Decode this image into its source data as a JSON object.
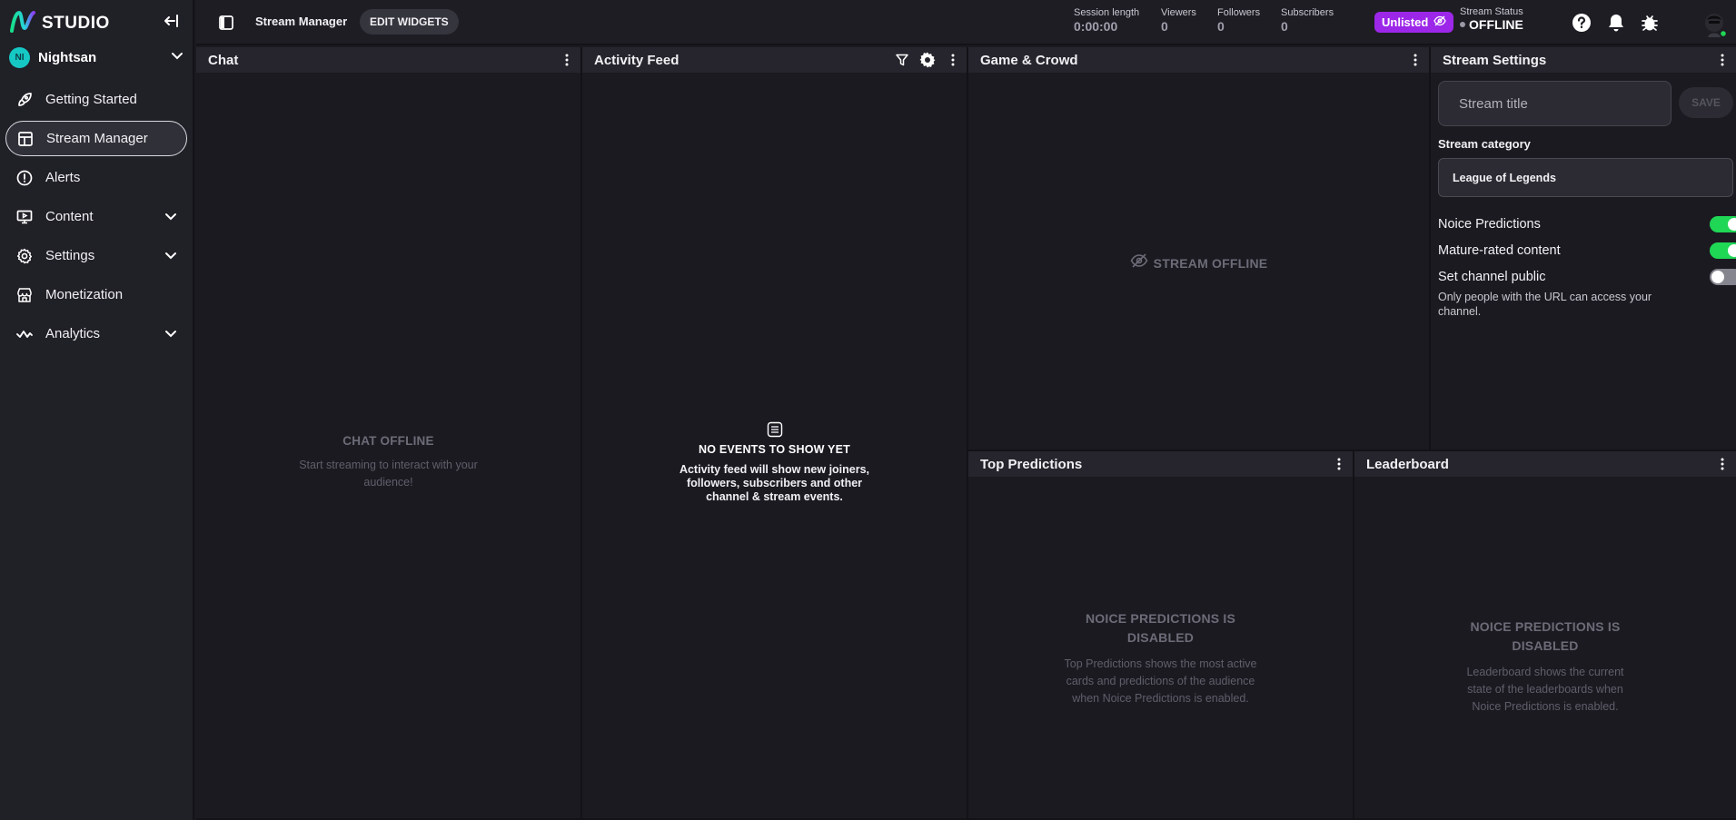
{
  "brand": {
    "name": "STUDIO"
  },
  "channel": {
    "initials": "NI",
    "name": "Nightsan"
  },
  "nav": {
    "items": [
      {
        "label": "Getting Started"
      },
      {
        "label": "Stream Manager"
      },
      {
        "label": "Alerts"
      },
      {
        "label": "Content"
      },
      {
        "label": "Settings"
      },
      {
        "label": "Monetization"
      },
      {
        "label": "Analytics"
      }
    ]
  },
  "topbar": {
    "breadcrumb": "Stream Manager",
    "edit_widgets": "EDIT WIDGETS",
    "stats": [
      {
        "label": "Session length",
        "value": "0:00:00"
      },
      {
        "label": "Viewers",
        "value": "0"
      },
      {
        "label": "Followers",
        "value": "0"
      },
      {
        "label": "Subscribers",
        "value": "0"
      }
    ],
    "visibility_badge": "Unlisted",
    "stream_status_label": "Stream Status",
    "stream_status_value": "OFFLINE"
  },
  "chat": {
    "title": "Chat",
    "empty_title": "CHAT OFFLINE",
    "empty_desc": "Start streaming to interact with your audience!"
  },
  "activity": {
    "title": "Activity Feed",
    "empty_title": "NO EVENTS TO SHOW YET",
    "empty_desc": "Activity feed will show new joiners, followers, subscribers and other channel & stream events."
  },
  "game": {
    "title": "Game & Crowd",
    "empty_title": "STREAM OFFLINE"
  },
  "settings": {
    "title": "Stream Settings",
    "title_placeholder": "Stream title",
    "title_value": "",
    "save_label": "SAVE",
    "category_label": "Stream category",
    "category_value": "League of Legends",
    "toggles": [
      {
        "label": "Noice Predictions",
        "on": true
      },
      {
        "label": "Mature-rated content",
        "on": true
      },
      {
        "label": "Set channel public",
        "on": false
      }
    ],
    "public_hint": "Only people with the URL can access your channel."
  },
  "predictions": {
    "title": "Top Predictions",
    "empty_title": "NOICE PREDICTIONS IS DISABLED",
    "empty_desc": "Top Predictions shows the most active cards and predictions of the audience when Noice Predictions is enabled."
  },
  "leaderboard": {
    "title": "Leaderboard",
    "empty_title": "NOICE PREDICTIONS IS DISABLED",
    "empty_desc": "Leaderboard shows the current state of the leaderboards when Noice Predictions is enabled."
  },
  "colors": {
    "accent_purple": "#9c27e8",
    "toggle_on": "#1fd655",
    "brand_gradient_start": "#16e08a",
    "brand_gradient_end": "#8b3df5"
  }
}
